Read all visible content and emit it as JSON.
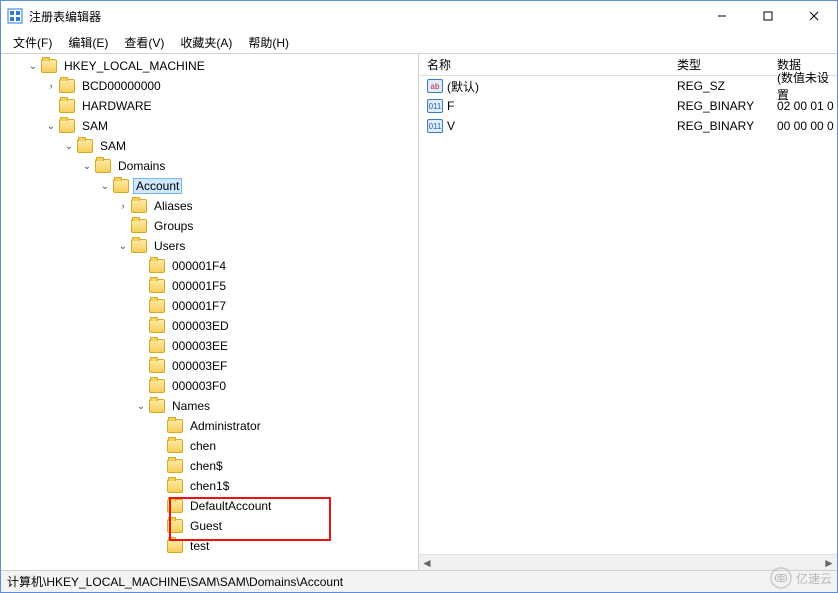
{
  "window": {
    "title": "注册表编辑器"
  },
  "menu": {
    "file": "文件(F)",
    "edit": "编辑(E)",
    "view": "查看(V)",
    "fav": "收藏夹(A)",
    "help": "帮助(H)"
  },
  "tree": {
    "root": "HKEY_LOCAL_MACHINE",
    "bcd": "BCD00000000",
    "hw": "HARDWARE",
    "sam": "SAM",
    "sam2": "SAM",
    "domains": "Domains",
    "account": "Account",
    "aliases": "Aliases",
    "groups": "Groups",
    "users": "Users",
    "u": [
      "000001F4",
      "000001F5",
      "000001F7",
      "000003ED",
      "000003EE",
      "000003EF",
      "000003F0"
    ],
    "names": "Names",
    "n": [
      "Administrator",
      "chen",
      "chen$",
      "chen1$",
      "DefaultAccount",
      "Guest",
      "test"
    ]
  },
  "list": {
    "headers": {
      "name": "名称",
      "type": "类型",
      "data": "数据"
    },
    "rows": [
      {
        "icon": "str",
        "name": "(默认)",
        "type": "REG_SZ",
        "data": "(数值未设置"
      },
      {
        "icon": "bin",
        "name": "F",
        "type": "REG_BINARY",
        "data": "02 00 01 0"
      },
      {
        "icon": "bin",
        "name": "V",
        "type": "REG_BINARY",
        "data": "00 00 00 0"
      }
    ]
  },
  "status": {
    "path": "计算机\\HKEY_LOCAL_MACHINE\\SAM\\SAM\\Domains\\Account"
  },
  "watermark": {
    "text": "亿速云"
  }
}
